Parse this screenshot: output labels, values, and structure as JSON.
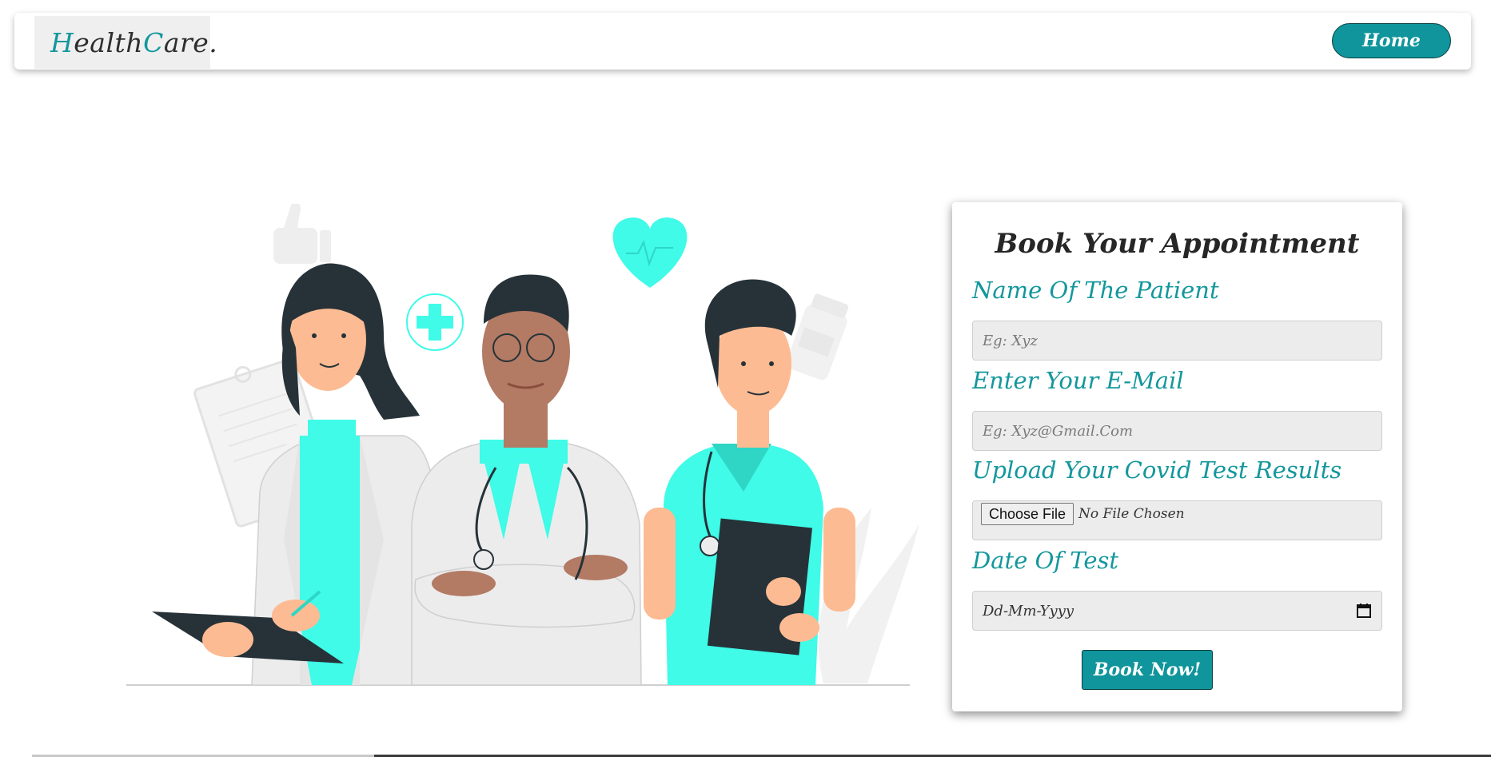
{
  "brand": {
    "part1_accent": "H",
    "part2": "ealth",
    "part3_accent": "C",
    "part4": "are."
  },
  "nav": {
    "home_label": "Home"
  },
  "form": {
    "title": "Book Your Appointment",
    "name_label": "Name Of The Patient",
    "name_placeholder": "Eg: Xyz",
    "email_label": "Enter Your E-Mail",
    "email_placeholder": "Eg: Xyz@Gmail.Com",
    "upload_label": "Upload Your Covid Test Results",
    "choose_file_label": "Choose File",
    "file_status": "No File Chosen",
    "date_label": "Date Of Test",
    "date_placeholder": "Dd-Mm-Yyyy",
    "submit_label": "Book Now!"
  },
  "colors": {
    "accent": "#13979c",
    "button": "#0f959b",
    "scrubs": "#3ffbe8"
  },
  "icons": [
    "calendar-icon",
    "heart-icon",
    "plus-icon",
    "thumbs-up-icon",
    "clipboard-icon",
    "medicine-bottle-icon"
  ]
}
